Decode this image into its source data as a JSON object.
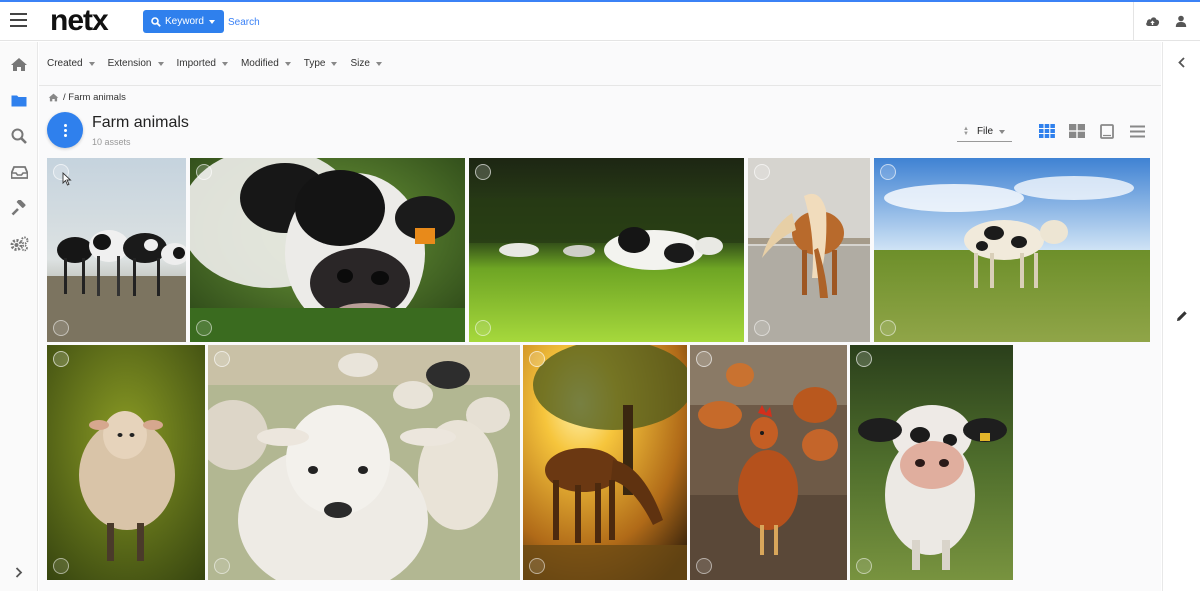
{
  "app": {
    "logo": "netx"
  },
  "search": {
    "mode_label": "Keyword",
    "placeholder": "Search",
    "value": ""
  },
  "filters": [
    "Created",
    "Extension",
    "Imported",
    "Modified",
    "Type",
    "Size"
  ],
  "breadcrumb": {
    "separator": "/",
    "current": "Farm animals"
  },
  "folder": {
    "title": "Farm animals",
    "asset_count": "10 assets"
  },
  "sort": {
    "label": "File"
  },
  "view_modes": [
    "grid-small",
    "grid-large",
    "single",
    "list"
  ],
  "assets": [
    {
      "name": "holstein-herd",
      "subject": "Holstein cows standing on a farm",
      "palette": [
        "#b9c9d6",
        "#d5dbd8",
        "#7b7560",
        "#181818"
      ]
    },
    {
      "name": "cow-closeup",
      "subject": "Black and white cow close-up in grass",
      "palette": [
        "#2e4f1d",
        "#4b7a2a",
        "#e8e6e3",
        "#1a1a1a"
      ]
    },
    {
      "name": "cows-resting",
      "subject": "Cows resting in a sunny field",
      "palette": [
        "#1f2a14",
        "#5c8e1f",
        "#9dd235",
        "#f2f2ef"
      ]
    },
    {
      "name": "pony-grazing",
      "subject": "Palomino pony grazing",
      "palette": [
        "#d9d7d2",
        "#bfbab0",
        "#8f8b82",
        "#b4662a"
      ]
    },
    {
      "name": "cow-pasture",
      "subject": "Spotted cow in a sunny pasture",
      "palette": [
        "#4a8ad6",
        "#cfe2f5",
        "#6d8f2a",
        "#f3ede0"
      ]
    },
    {
      "name": "sheep-field",
      "subject": "Sheep standing in a golden field",
      "palette": [
        "#3b4a12",
        "#7a8c1e",
        "#b3a07a",
        "#e6d3b8"
      ]
    },
    {
      "name": "lamb-closeup",
      "subject": "Woolly lamb close-up with flock",
      "palette": [
        "#cfc4a8",
        "#a8b58a",
        "#efeae2",
        "#3a3a3a"
      ]
    },
    {
      "name": "horse-sunset",
      "subject": "Horse grazing at sunset",
      "palette": [
        "#f7c23d",
        "#c97a1d",
        "#6b3c14",
        "#2d1e0d"
      ]
    },
    {
      "name": "hens",
      "subject": "Brown hens in a farmyard",
      "palette": [
        "#6e5a47",
        "#b5591e",
        "#d97c35",
        "#4a3a2c"
      ]
    },
    {
      "name": "curious-cow",
      "subject": "Curious cow looking into camera",
      "palette": [
        "#2f4a1f",
        "#6d8b3a",
        "#e4b8a8",
        "#1b1b1b"
      ]
    }
  ],
  "icons": {
    "menu": "menu-icon",
    "search_btn": "search-icon",
    "upload": "cloud-upload-icon",
    "user": "user-icon",
    "home": "home-icon",
    "folder": "folder-icon",
    "search_nav": "search-icon",
    "inbox": "inbox-icon",
    "tools": "hammer-icon",
    "settings": "gears-icon",
    "expand": "chevron-right-icon",
    "collapse": "chevron-left-icon",
    "edit": "pencil-icon"
  },
  "colors": {
    "accent": "#2f80ed",
    "active_nav": "#2f80ed"
  }
}
